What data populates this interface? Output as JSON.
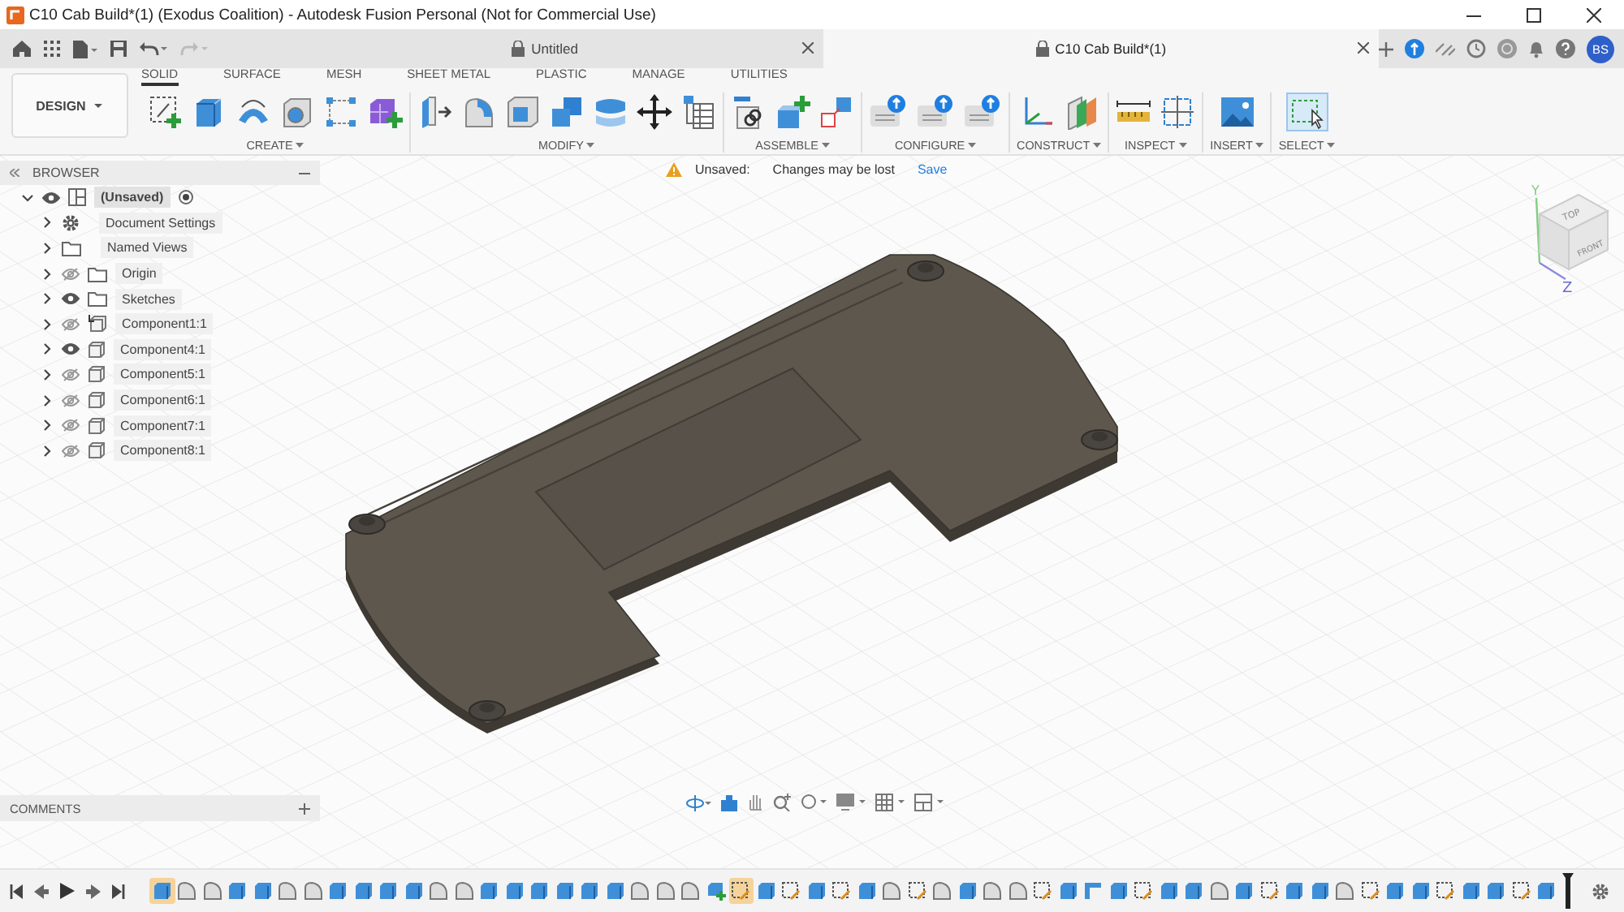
{
  "window": {
    "title": "C10 Cab Build*(1) (Exodus Coalition) - Autodesk Fusion Personal (Not for Commercial Use)"
  },
  "doc_tabs": [
    {
      "title": "Untitled",
      "selected": false
    },
    {
      "title": "C10 Cab Build*(1)",
      "selected": true
    }
  ],
  "user": {
    "initials": "BS"
  },
  "workspace": {
    "label": "DESIGN"
  },
  "toolbar_tabs": [
    {
      "label": "SOLID",
      "selected": true
    },
    {
      "label": "SURFACE",
      "selected": false
    },
    {
      "label": "MESH",
      "selected": false
    },
    {
      "label": "SHEET METAL",
      "selected": false
    },
    {
      "label": "PLASTIC",
      "selected": false
    },
    {
      "label": "MANAGE",
      "selected": false
    },
    {
      "label": "UTILITIES",
      "selected": false
    }
  ],
  "tool_groups": [
    {
      "label": "CREATE",
      "tools": [
        {
          "kind": "sketch"
        },
        {
          "kind": "box"
        },
        {
          "kind": "arch"
        },
        {
          "kind": "hole"
        },
        {
          "kind": "pattern"
        },
        {
          "kind": "form"
        }
      ]
    },
    {
      "label": "MODIFY",
      "tools": [
        {
          "kind": "presspull"
        },
        {
          "kind": "fillet"
        },
        {
          "kind": "shell"
        },
        {
          "kind": "combine"
        },
        {
          "kind": "faces"
        },
        {
          "kind": "move"
        },
        {
          "kind": "table"
        }
      ]
    },
    {
      "label": "ASSEMBLE",
      "tools": [
        {
          "kind": "joint"
        },
        {
          "kind": "newcomp"
        },
        {
          "kind": "rigid"
        }
      ]
    },
    {
      "label": "CONFIGURE",
      "tools": [
        {
          "kind": "config"
        },
        {
          "kind": "config"
        },
        {
          "kind": "config"
        }
      ]
    },
    {
      "label": "CONSTRUCT",
      "tools": [
        {
          "kind": "axes"
        },
        {
          "kind": "plane"
        }
      ]
    },
    {
      "label": "INSPECT",
      "tools": [
        {
          "kind": "ruler"
        },
        {
          "kind": "section"
        }
      ]
    },
    {
      "label": "INSERT",
      "tools": [
        {
          "kind": "image"
        }
      ]
    },
    {
      "label": "SELECT",
      "tools": [
        {
          "kind": "select"
        }
      ]
    }
  ],
  "browser": {
    "title": "BROWSER",
    "root": {
      "label": "(Unsaved)",
      "selected": true,
      "expanded": true,
      "visible": true,
      "children": [
        {
          "label": "Document Settings",
          "kind": "settings",
          "selected": false,
          "expanded": false
        },
        {
          "label": "Named Views",
          "kind": "folder",
          "selected": false,
          "expanded": false
        },
        {
          "label": "Origin",
          "kind": "folder",
          "selected": false,
          "expanded": false,
          "visible": false
        },
        {
          "label": "Sketches",
          "kind": "folder",
          "selected": false,
          "expanded": false,
          "visible": true
        },
        {
          "label": "Component1:1",
          "kind": "linked",
          "selected": false,
          "expanded": false,
          "visible": false
        },
        {
          "label": "Component4:1",
          "kind": "component",
          "selected": false,
          "expanded": false,
          "visible": true
        },
        {
          "label": "Component5:1",
          "kind": "component",
          "selected": false,
          "expanded": false,
          "visible": false
        },
        {
          "label": "Component6:1",
          "kind": "component",
          "selected": false,
          "expanded": false,
          "visible": false
        },
        {
          "label": "Component7:1",
          "kind": "component",
          "selected": false,
          "expanded": false,
          "visible": false
        },
        {
          "label": "Component8:1",
          "kind": "component",
          "selected": false,
          "expanded": false,
          "visible": false
        }
      ]
    }
  },
  "notice": {
    "label": "Unsaved:",
    "message": "Changes may be lost",
    "action": "Save"
  },
  "view_cube": {
    "top": "TOP",
    "front": "FRONT",
    "y_axis": "Y",
    "z_axis": "Z"
  },
  "comments": {
    "title": "COMMENTS"
  },
  "timeline": {
    "features": [
      {
        "kind": "extrude",
        "selected": true
      },
      {
        "kind": "fillet",
        "selected": false
      },
      {
        "kind": "fillet",
        "selected": false
      },
      {
        "kind": "extrude",
        "selected": false
      },
      {
        "kind": "extrude",
        "selected": false
      },
      {
        "kind": "fillet",
        "selected": false
      },
      {
        "kind": "fillet",
        "selected": false
      },
      {
        "kind": "extrude",
        "selected": false
      },
      {
        "kind": "extrude",
        "selected": false
      },
      {
        "kind": "extrude",
        "selected": false
      },
      {
        "kind": "extrude",
        "selected": false
      },
      {
        "kind": "fillet",
        "selected": false
      },
      {
        "kind": "fillet",
        "selected": false
      },
      {
        "kind": "extrude",
        "selected": false
      },
      {
        "kind": "extrude",
        "selected": false
      },
      {
        "kind": "extrude",
        "selected": false
      },
      {
        "kind": "extrude",
        "selected": false
      },
      {
        "kind": "extrude",
        "selected": false
      },
      {
        "kind": "extrude",
        "selected": false
      },
      {
        "kind": "fillet",
        "selected": false
      },
      {
        "kind": "fillet",
        "selected": false
      },
      {
        "kind": "fillet",
        "selected": false
      },
      {
        "kind": "component",
        "selected": false
      },
      {
        "kind": "sketch",
        "selected": true
      },
      {
        "kind": "extrude",
        "selected": false
      },
      {
        "kind": "sketch",
        "selected": false
      },
      {
        "kind": "extrude",
        "selected": false
      },
      {
        "kind": "sketch",
        "selected": false
      },
      {
        "kind": "extrude",
        "selected": false
      },
      {
        "kind": "fillet",
        "selected": false
      },
      {
        "kind": "sketch",
        "selected": false
      },
      {
        "kind": "fillet",
        "selected": false
      },
      {
        "kind": "extrude",
        "selected": false
      },
      {
        "kind": "fillet",
        "selected": false
      },
      {
        "kind": "fillet",
        "selected": false
      },
      {
        "kind": "sketch",
        "selected": false
      },
      {
        "kind": "extrude",
        "selected": false
      },
      {
        "kind": "rib",
        "selected": false
      },
      {
        "kind": "extrude",
        "selected": false
      },
      {
        "kind": "sketch",
        "selected": false
      },
      {
        "kind": "extrude",
        "selected": false
      },
      {
        "kind": "extrude",
        "selected": false
      },
      {
        "kind": "fillet",
        "selected": false
      },
      {
        "kind": "extrude",
        "selected": false
      },
      {
        "kind": "sketch",
        "selected": false
      },
      {
        "kind": "extrude",
        "selected": false
      },
      {
        "kind": "extrude",
        "selected": false
      },
      {
        "kind": "fillet",
        "selected": false
      },
      {
        "kind": "sketch",
        "selected": false
      },
      {
        "kind": "extrude",
        "selected": false
      },
      {
        "kind": "extrude",
        "selected": false
      },
      {
        "kind": "sketch",
        "selected": false
      },
      {
        "kind": "extrude",
        "selected": false
      },
      {
        "kind": "extrude",
        "selected": false
      },
      {
        "kind": "sketch",
        "selected": false
      },
      {
        "kind": "extrude",
        "selected": false
      }
    ]
  }
}
